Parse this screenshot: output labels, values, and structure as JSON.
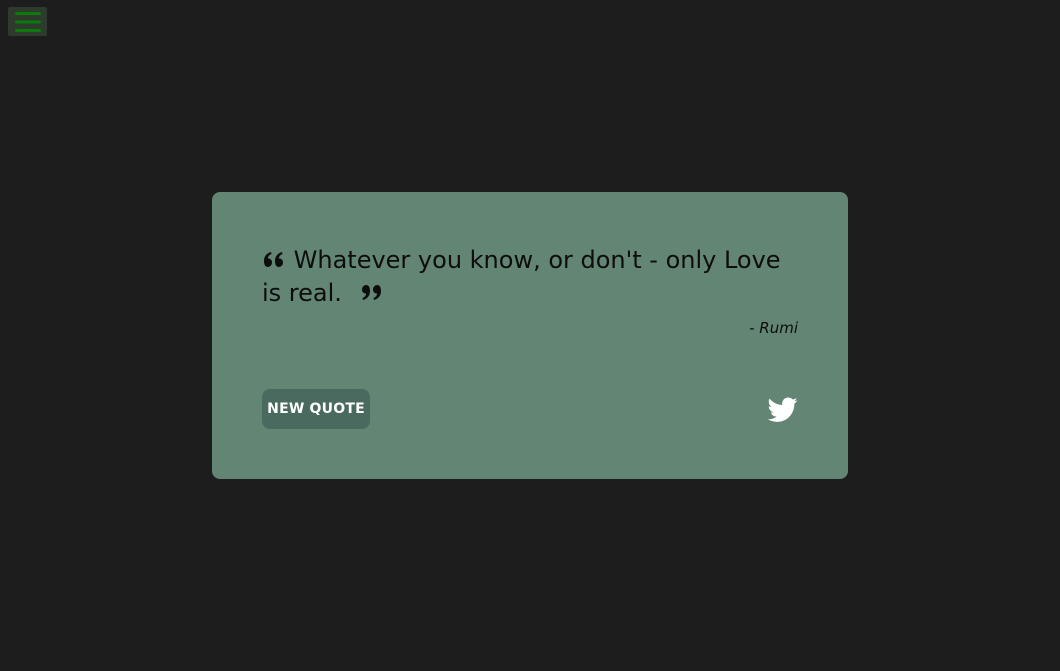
{
  "menu": {
    "icon": "hamburger-icon",
    "icon_color": "#0a7a0a"
  },
  "quote": {
    "text": "Whatever you know, or don't - only Love is real.",
    "author": "- Rumi",
    "open_icon": "quote-left-icon",
    "close_icon": "quote-right-icon"
  },
  "actions": {
    "new_quote_label": "NEW QUOTE",
    "tweet_icon": "twitter-icon"
  },
  "colors": {
    "background": "#1d1d1d",
    "card": "#638573",
    "button": "#4a6a60",
    "text": "#0d0d0d"
  }
}
